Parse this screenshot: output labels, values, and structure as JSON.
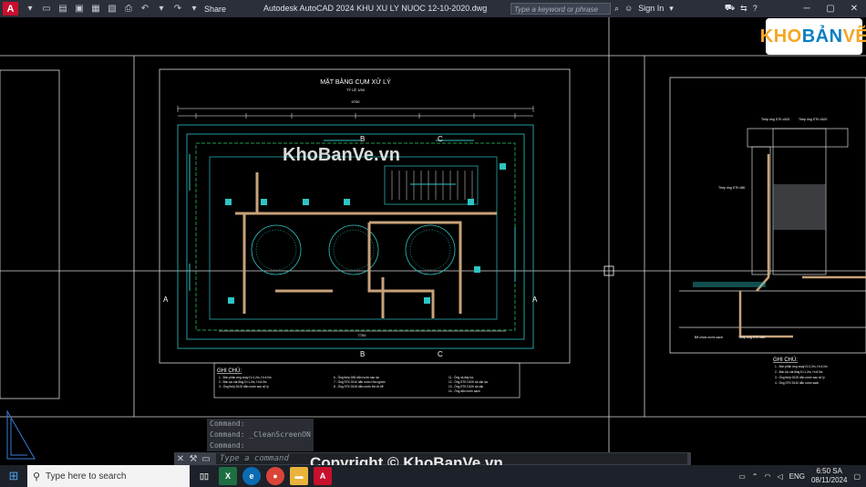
{
  "app": {
    "title": "Autodesk AutoCAD 2024    KHU XU LY NUOC 12-10-2020.dwg",
    "share": "Share",
    "search_placeholder": "Type a keyword or phrase",
    "sign_in": "Sign In"
  },
  "drawing": {
    "main_title": "MẶT BẰNG CỤM XỬ LÝ",
    "scale": "TỶ LỆ 1/50",
    "section_b": "B",
    "section_c": "C",
    "section_a": "A",
    "dim_total": "9700",
    "dim_bottom": "7700",
    "notes_title": "GHI CHÚ:",
    "notes_col1": [
      "1 - Bồn phản ứng xoáy D=1.2m, H=4.0m",
      "2 - Bồn lọc cát lắng D=1.2m, H=5.0m",
      "3 - Ống thép D100 dẫn nước sau xử lý"
    ],
    "notes_col2": [
      "6 - Ống thép D50 dẫn nước sau lọc",
      "7 - Ống STK D110 dẫn nước rửa ngược",
      "8 - Ống STK D100 dẫn nước thô từ bể"
    ],
    "notes_col3": [
      "11 - Ống xả đáy lọc",
      "12 - Ống STK D100 xả cặn lọc",
      "13 - Ống STK D100 xả cặn",
      "14 - Ống dẫn nước sạch"
    ],
    "right_notes_title": "GHI CHÚ:",
    "right_notes": [
      "1 - Bồn phản ứng xoáy D=1.2m, H=4.0m",
      "2 - Bồn lọc cát lắng D=1.2m, H=5.0m",
      "3 - Ống thép D100 dẫn nước sau xử lý",
      "4 - Ống STK D110 dẫn nước sạch"
    ],
    "right_labels": [
      "Thép ống STK d100",
      "Thép ống STK d100",
      "Thép ống STK d50",
      "Bể chứa nước sạch",
      "Thép ống STK d50"
    ]
  },
  "watermarks": {
    "center": "KhoBanVe.vn",
    "bottom": "Copyright © KhoBanVe.vn",
    "brand_a": "KHO",
    "brand_b": "BẢN",
    "brand_c": "VẼ"
  },
  "command": {
    "history": [
      "Command:",
      "Command:  _CleanScreenON",
      "Command:"
    ],
    "placeholder": "Type a command"
  },
  "taskbar": {
    "search": "Type here to search",
    "lang": "ENG",
    "time": "6:50 SA",
    "date": "08/11/2024"
  }
}
